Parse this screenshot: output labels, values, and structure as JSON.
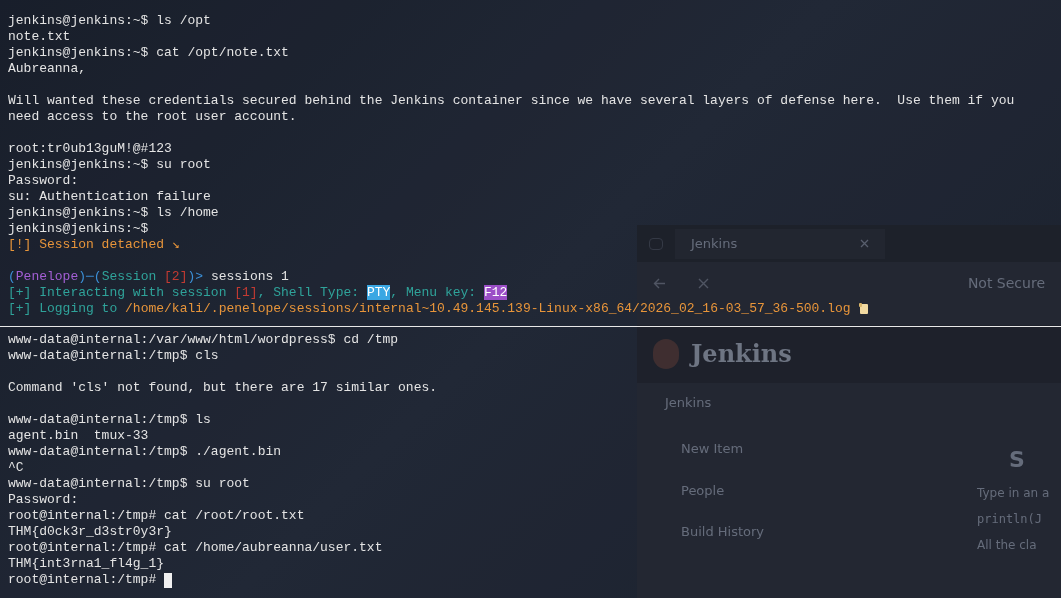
{
  "background_window": {
    "tab": {
      "title": "Jenkins"
    },
    "address": {
      "security": "Not Secure"
    },
    "header": {
      "title": "Jenkins"
    },
    "breadcrumb": "Jenkins",
    "sidebar": [
      "New Item",
      "People",
      "Build History"
    ],
    "content": {
      "heading": "S",
      "text": "Type in an a",
      "code": "println(J",
      "footer": "All the cla"
    }
  },
  "terminal": {
    "lines": [
      {
        "kind": "text",
        "segments": [
          {
            "kind": "plain",
            "text": "jenkins@jenkins:~$ ls /opt"
          }
        ]
      },
      {
        "kind": "text",
        "segments": [
          {
            "kind": "plain",
            "text": "note.txt"
          }
        ]
      },
      {
        "kind": "text",
        "segments": [
          {
            "kind": "plain",
            "text": "jenkins@jenkins:~$ cat /opt/note.txt"
          }
        ]
      },
      {
        "kind": "text",
        "segments": [
          {
            "kind": "plain",
            "text": "Aubreanna,"
          }
        ]
      },
      {
        "kind": "blank"
      },
      {
        "kind": "text",
        "segments": [
          {
            "kind": "plain",
            "text": "Will wanted these credentials secured behind the Jenkins container since we have several layers of defense here.  Use them if you"
          }
        ]
      },
      {
        "kind": "text",
        "segments": [
          {
            "kind": "plain",
            "text": "need access to the root user account."
          }
        ]
      },
      {
        "kind": "blank"
      },
      {
        "kind": "text",
        "segments": [
          {
            "kind": "plain",
            "text": "root:tr0ub13guM!@#123"
          }
        ]
      },
      {
        "kind": "text",
        "segments": [
          {
            "kind": "plain",
            "text": "jenkins@jenkins:~$ su root"
          }
        ]
      },
      {
        "kind": "text",
        "segments": [
          {
            "kind": "plain",
            "text": "Password:"
          }
        ]
      },
      {
        "kind": "text",
        "segments": [
          {
            "kind": "plain",
            "text": "su: Authentication failure"
          }
        ]
      },
      {
        "kind": "text",
        "segments": [
          {
            "kind": "plain",
            "text": "jenkins@jenkins:~$ ls /home"
          }
        ]
      },
      {
        "kind": "text",
        "segments": [
          {
            "kind": "plain",
            "text": "jenkins@jenkins:~$"
          }
        ]
      },
      {
        "kind": "text",
        "segments": [
          {
            "kind": "warn",
            "text": "[!] Session detached ↘"
          }
        ]
      },
      {
        "kind": "blank"
      },
      {
        "kind": "text",
        "segments": [
          {
            "kind": "bracket",
            "text": "("
          },
          {
            "kind": "name",
            "text": "Penelope"
          },
          {
            "kind": "bracket",
            "text": ")─("
          },
          {
            "kind": "info",
            "text": "Session "
          },
          {
            "kind": "index",
            "text": "[2]"
          },
          {
            "kind": "bracket",
            "text": ")>"
          },
          {
            "kind": "plain",
            "text": " sessions 1"
          }
        ]
      },
      {
        "kind": "text",
        "segments": [
          {
            "kind": "info",
            "text": "[+] Interacting with session "
          },
          {
            "kind": "index",
            "text": "[1]"
          },
          {
            "kind": "info",
            "text": ", Shell Type: "
          },
          {
            "kind": "badge_blue",
            "text": "PTY"
          },
          {
            "kind": "info",
            "text": ", Menu key: "
          },
          {
            "kind": "badge_purple",
            "text": "F12"
          }
        ]
      },
      {
        "kind": "log",
        "segments": [
          {
            "kind": "info",
            "text": "[+] Logging to "
          },
          {
            "kind": "path",
            "text": "/home/kali/.penelope/sessions/internal~10.49.145.139-Linux-x86_64/2026_02_16-03_57_36-500.log"
          }
        ]
      },
      {
        "kind": "rule"
      },
      {
        "kind": "text",
        "segments": [
          {
            "kind": "plain",
            "text": "www-data@internal:/var/www/html/wordpress$ cd /tmp"
          }
        ]
      },
      {
        "kind": "text",
        "segments": [
          {
            "kind": "plain",
            "text": "www-data@internal:/tmp$ cls"
          }
        ]
      },
      {
        "kind": "blank"
      },
      {
        "kind": "text",
        "segments": [
          {
            "kind": "plain",
            "text": "Command 'cls' not found, but there are 17 similar ones."
          }
        ]
      },
      {
        "kind": "blank"
      },
      {
        "kind": "text",
        "segments": [
          {
            "kind": "plain",
            "text": "www-data@internal:/tmp$ ls"
          }
        ]
      },
      {
        "kind": "text",
        "segments": [
          {
            "kind": "plain",
            "text": "agent.bin  tmux-33"
          }
        ]
      },
      {
        "kind": "text",
        "segments": [
          {
            "kind": "plain",
            "text": "www-data@internal:/tmp$ ./agent.bin"
          }
        ]
      },
      {
        "kind": "text",
        "segments": [
          {
            "kind": "plain",
            "text": "^C"
          }
        ]
      },
      {
        "kind": "text",
        "segments": [
          {
            "kind": "plain",
            "text": "www-data@internal:/tmp$ su root"
          }
        ]
      },
      {
        "kind": "text",
        "segments": [
          {
            "kind": "plain",
            "text": "Password:"
          }
        ]
      },
      {
        "kind": "text",
        "segments": [
          {
            "kind": "plain",
            "text": "root@internal:/tmp# cat /root/root.txt"
          }
        ]
      },
      {
        "kind": "text",
        "segments": [
          {
            "kind": "plain",
            "text": "THM{d0ck3r_d3str0y3r}"
          }
        ]
      },
      {
        "kind": "text",
        "segments": [
          {
            "kind": "plain",
            "text": "root@internal:/tmp# cat /home/aubreanna/user.txt"
          }
        ]
      },
      {
        "kind": "text",
        "segments": [
          {
            "kind": "plain",
            "text": "THM{int3rna1_fl4g_1}"
          }
        ]
      },
      {
        "kind": "text",
        "cursor": true,
        "segments": [
          {
            "kind": "plain",
            "text": "root@internal:/tmp# "
          }
        ]
      }
    ]
  }
}
